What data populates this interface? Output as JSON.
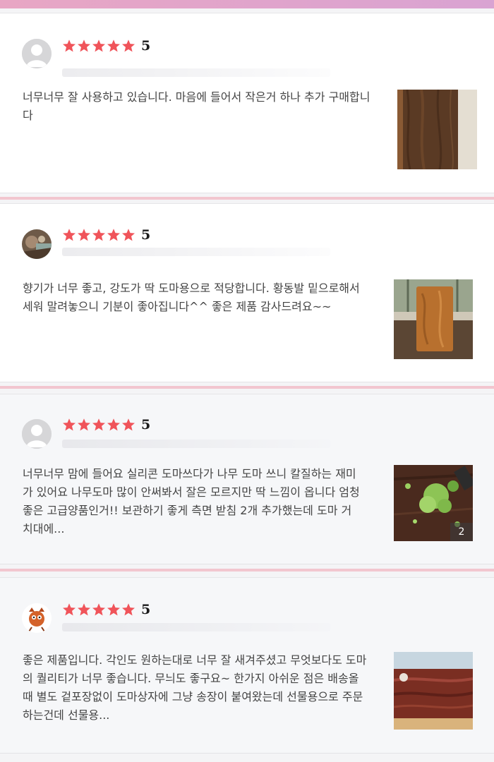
{
  "colors": {
    "star": "#f0545a",
    "top_band": "#e2a5cb",
    "separator": "#f2c6cf"
  },
  "reviews": [
    {
      "avatar": "default-avatar-icon",
      "stars": 5,
      "rating": "5",
      "text": "너무너무 잘 사용하고 있습니다. 마음에 들어서 작은거 하나 추가 구매합니다",
      "photo": "walnut-board-photo"
    },
    {
      "avatar": "user-photo-avatar",
      "stars": 5,
      "rating": "5",
      "text": "향기가 너무 좋고, 강도가 딱 도마용으로 적당합니다. 황동발 밑으로해서 세워 말려놓으니 기분이 좋아집니다^^ 좋은 제품 감사드려요~~",
      "photo": "standing-board-photo"
    },
    {
      "avatar": "default-avatar-icon",
      "stars": 5,
      "rating": "5",
      "text": "너무너무 맘에 들어요 실리콘 도마쓰다가 나무 도마 쓰니 칼질하는 재미가 있어요 나무도마 많이 안써봐서 잘은 모르지만 딱 느낌이 옵니다 엄청 좋은 고급양품인거!! 보관하기 좋게 측면 받침 2개 추가했는데 도마 거치대에...",
      "photo": "chopped-greens-photo",
      "photo_count": "2"
    },
    {
      "avatar": "cartoon-avatar-icon",
      "stars": 5,
      "rating": "5",
      "text": "좋은 제품입니다. 각인도 원하는대로 너무 잘 새겨주셨고 무엇보다도 도마의 퀄리티가 너무 좋습니다. 무늬도 좋구요~ 한가지 아쉬운 점은 배송올때 별도 겉포장없이 도마상자에 그냥 송장이 붙여왔는데 선물용으로 주문하는건데 선물용...",
      "photo": "wrapped-board-photo"
    }
  ]
}
